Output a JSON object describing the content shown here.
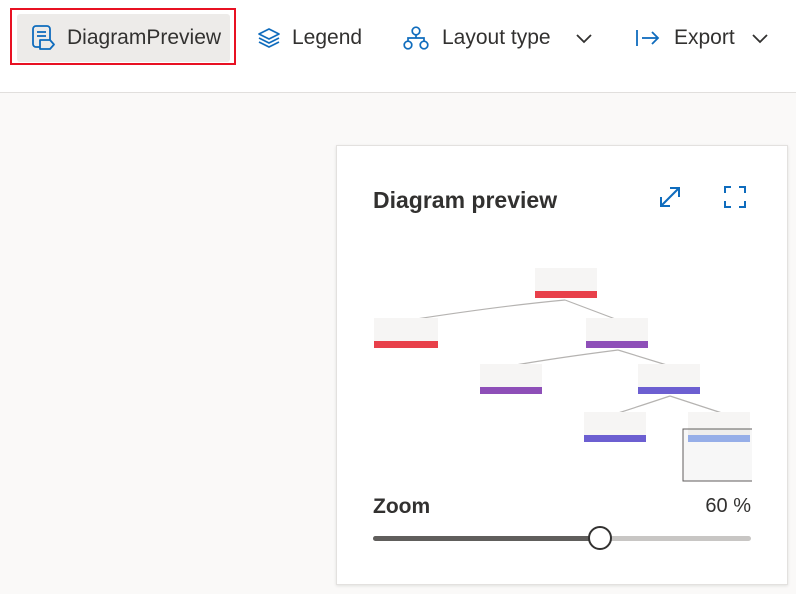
{
  "toolbar": {
    "diagram_preview": {
      "label": "DiagramPreview",
      "icon": "diagram-preview-icon",
      "selected": true
    },
    "legend": {
      "label": "Legend",
      "icon": "layers-icon"
    },
    "layout_type": {
      "label": "Layout type",
      "icon": "org-chart-icon"
    },
    "export": {
      "label": "Export",
      "icon": "export-arrow-icon"
    }
  },
  "preview_panel": {
    "title": "Diagram preview",
    "zoom": {
      "label": "Zoom",
      "value_text": "60 %",
      "value": 60,
      "min": 0,
      "max": 100
    }
  },
  "colors": {
    "accent": "#0f6cbd",
    "highlight_border": "#e81123",
    "node_red": "#e8404a",
    "node_purple": "#8e4fb8",
    "node_violet": "#6c5fd1",
    "node_light_blue": "#9bb4f0"
  }
}
